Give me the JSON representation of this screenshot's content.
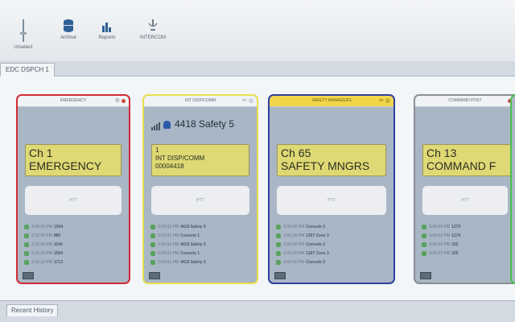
{
  "toolbar": {
    "unselect": "Unselect",
    "archive": "Archive",
    "reports": "Reports",
    "intercom": "INTERCOM"
  },
  "tabs": {
    "active": "EDC DSPCH 1"
  },
  "cards": [
    {
      "title": "EMERGENCY",
      "channel": "Ch 1",
      "name": "EMERGENCY",
      "talker": "",
      "ptt": "PTT",
      "history": [
        {
          "time": "3:03:50 PM",
          "text": "1594"
        },
        {
          "time": "2:11:59 PM",
          "text": "880"
        },
        {
          "time": "2:11:43 PM",
          "text": "1194"
        },
        {
          "time": "2:11:14 PM",
          "text": "1594"
        },
        {
          "time": "2:11:13 PM",
          "text": "1713"
        }
      ]
    },
    {
      "title": "INT DISP/COMM",
      "talker": "4418 Safety 5",
      "line1": "1",
      "line2": "INT DISP/COMM",
      "line3": "00004418",
      "ptt": "PTT",
      "history": [
        {
          "time": "3:03:51 PM",
          "text": "4418 Safety 5"
        },
        {
          "time": "3:03:51 PM",
          "text": "Console 1"
        },
        {
          "time": "3:03:51 PM",
          "text": "4418 Safety 5"
        },
        {
          "time": "3:03:51 PM",
          "text": "Console 1"
        },
        {
          "time": "3:03:51 PM",
          "text": "4418 Safety 5"
        }
      ]
    },
    {
      "title": "SAFETY MANAGERS",
      "channel": "Ch 65",
      "name": "SAFETY MNGRS",
      "ptt": "PTT",
      "history": [
        {
          "time": "3:03:50 PM",
          "text": "Console 2"
        },
        {
          "time": "3:02:38 PM",
          "text": "1307 Zone 3"
        },
        {
          "time": "3:02:38 PM",
          "text": "Console 2"
        },
        {
          "time": "3:02:35 PM",
          "text": "1307 Zone 3"
        },
        {
          "time": "3:02:35 PM",
          "text": "Console 2"
        }
      ]
    },
    {
      "title": "COMMAND POST",
      "channel": "Ch 13",
      "name": "COMMAND F",
      "ptt": "PTT",
      "history": [
        {
          "time": "3:03:55 PM",
          "text": "1279"
        },
        {
          "time": "3:03:50 PM",
          "text": "1279"
        },
        {
          "time": "3:03:40 PM",
          "text": "325"
        },
        {
          "time": "3:03:37 PM",
          "text": "325"
        }
      ]
    }
  ],
  "bottom": {
    "recent_history": "Recent History"
  },
  "colors": {
    "accent_yellow": "#ded974",
    "emergency": "#d22b35",
    "safety": "#2f3f9e"
  },
  "icons": [
    "unselect-icon",
    "archive-icon",
    "reports-icon",
    "intercom-icon",
    "settings-icon",
    "close-icon",
    "user-icon",
    "signal-icon"
  ]
}
